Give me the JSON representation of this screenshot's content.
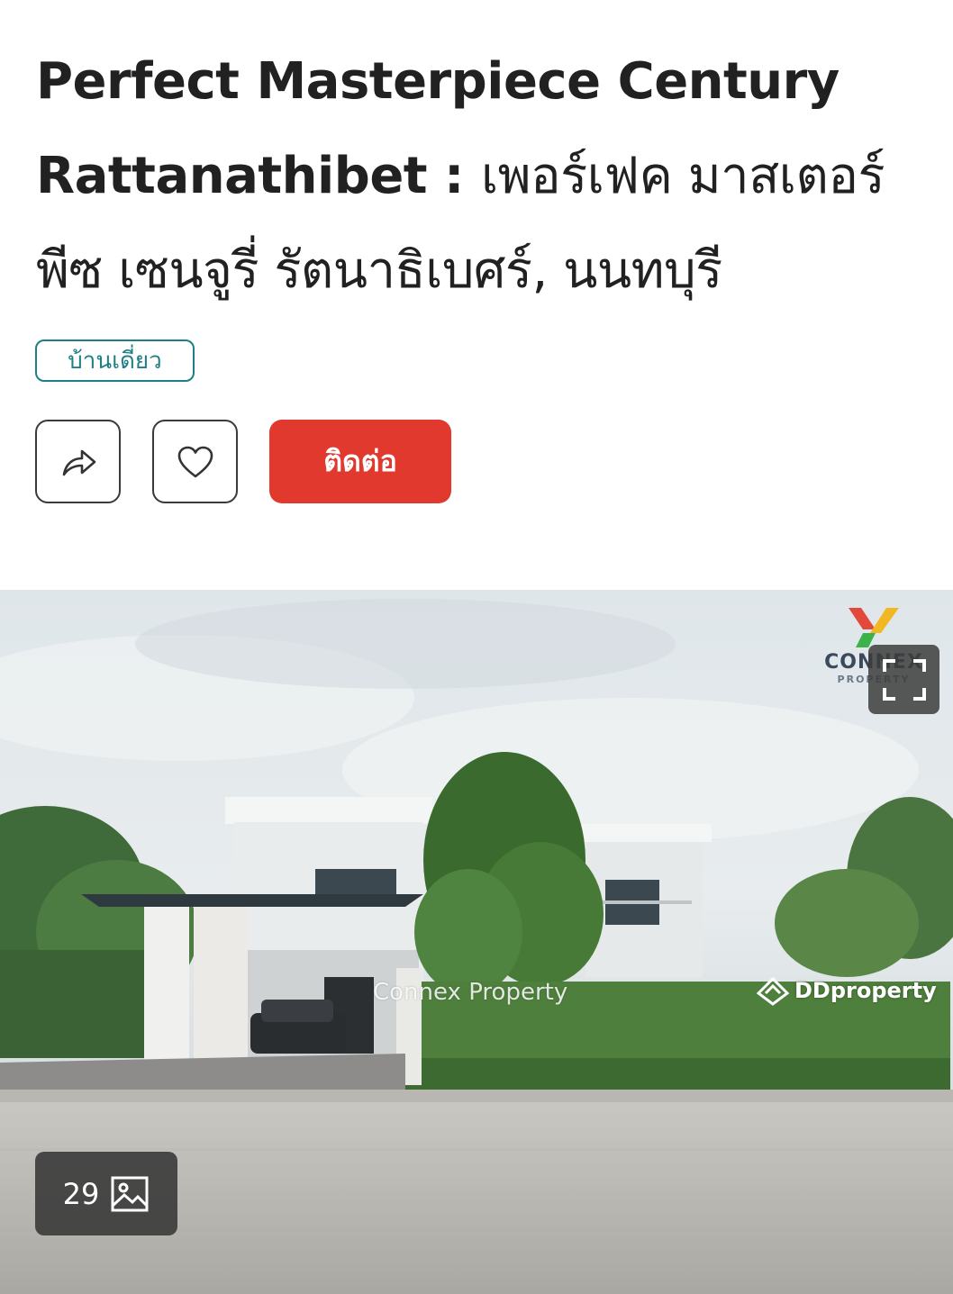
{
  "listing": {
    "title_en": "Perfect Masterpiece Century Rattanathibet :",
    "title_th": "เพอร์เฟค มาสเตอร์พีซ เซนจูรี่ รัตนาธิเบศร์, นนทบุรี",
    "property_type": "บ้านเดี่ยว"
  },
  "actions": {
    "share_icon": "share-icon",
    "favorite_icon": "heart-icon",
    "contact_label": "ติดต่อ",
    "contact_color": "#e2392f"
  },
  "gallery": {
    "photo_count": "29",
    "photo_icon": "image-icon",
    "fullscreen_icon": "fullscreen-icon",
    "watermark_center": "Connex Property",
    "watermark_right": "DDproperty",
    "logo_text": "CONNEX",
    "logo_subtext": "PROPERTY"
  },
  "colors": {
    "accent_teal": "#1f7f86",
    "cta_red": "#e2392f"
  }
}
